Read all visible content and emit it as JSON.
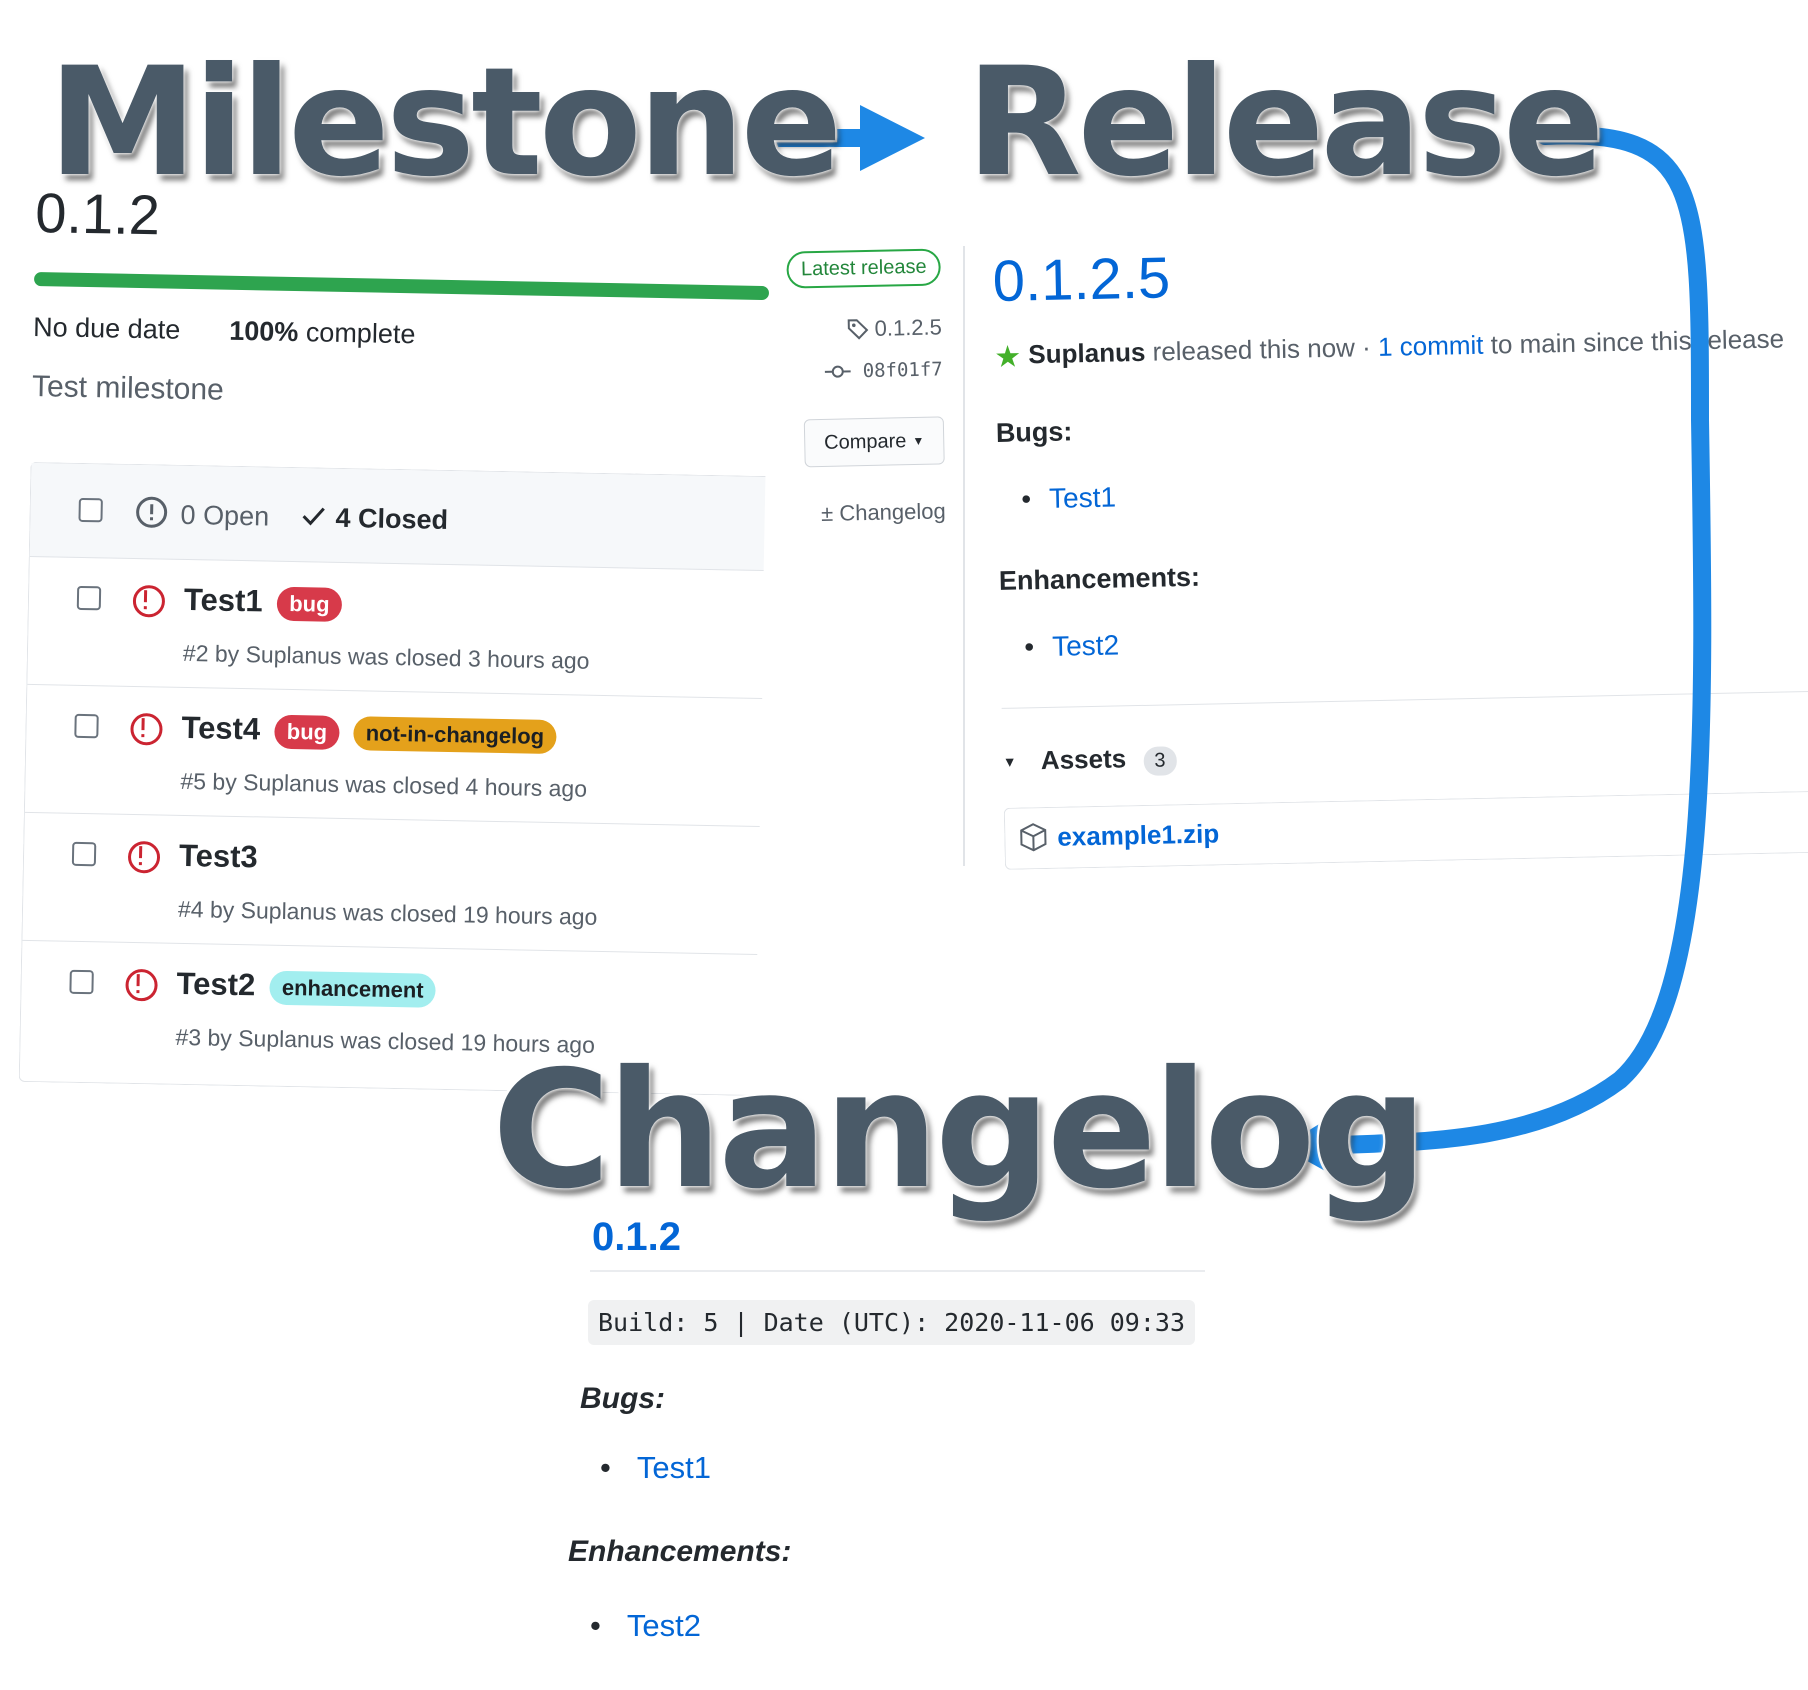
{
  "headings": {
    "milestone": "Milestone",
    "release": "Release",
    "changelog": "Changelog"
  },
  "milestone": {
    "title": "0.1.2",
    "progress": 1.0,
    "due": "No due date",
    "percent": "100%",
    "complete_label": "complete",
    "description": "Test milestone",
    "open_count": "0 Open",
    "closed_count": "4 Closed",
    "issues": [
      {
        "title": "Test1",
        "labels": [
          "bug"
        ],
        "meta": "#2 by Suplanus was closed 3 hours ago"
      },
      {
        "title": "Test4",
        "labels": [
          "bug",
          "not-in-changelog"
        ],
        "meta": "#5 by Suplanus was closed 4 hours ago"
      },
      {
        "title": "Test3",
        "labels": [],
        "meta": "#4 by Suplanus was closed 19 hours ago"
      },
      {
        "title": "Test2",
        "labels": [
          "enhancement"
        ],
        "meta": "#3 by Suplanus was closed 19 hours ago"
      }
    ]
  },
  "release": {
    "latest_badge": "Latest release",
    "tag": "0.1.2.5",
    "commit": "08f01f7",
    "compare_label": "Compare",
    "changelog_link": "Changelog",
    "version": "0.1.2.5",
    "author": "Suplanus",
    "released_text": "released this now ·",
    "commit_link": "1 commit",
    "since_text": "to main since this release",
    "bugs_heading": "Bugs:",
    "bugs": [
      "Test1"
    ],
    "enh_heading": "Enhancements:",
    "enhancements": [
      "Test2"
    ],
    "assets_label": "Assets",
    "assets_count": "3",
    "asset_file": "example1.zip"
  },
  "changelog": {
    "version": "0.1.2",
    "build_line": "Build: 5 | Date (UTC): 2020-11-06 09:33",
    "bugs_heading": "Bugs:",
    "bugs": [
      "Test1"
    ],
    "enh_heading": "Enhancements:",
    "enhancements": [
      "Test2"
    ]
  },
  "colors": {
    "accent_blue": "#0366d6",
    "arrow_blue": "#1e88e5",
    "progress_green": "#2ea44f",
    "label_bug": "#d73a4a",
    "label_not_in_changelog": "#e4a11b",
    "label_enhancement": "#a2eeef",
    "heading_text": "#4a5a68"
  }
}
